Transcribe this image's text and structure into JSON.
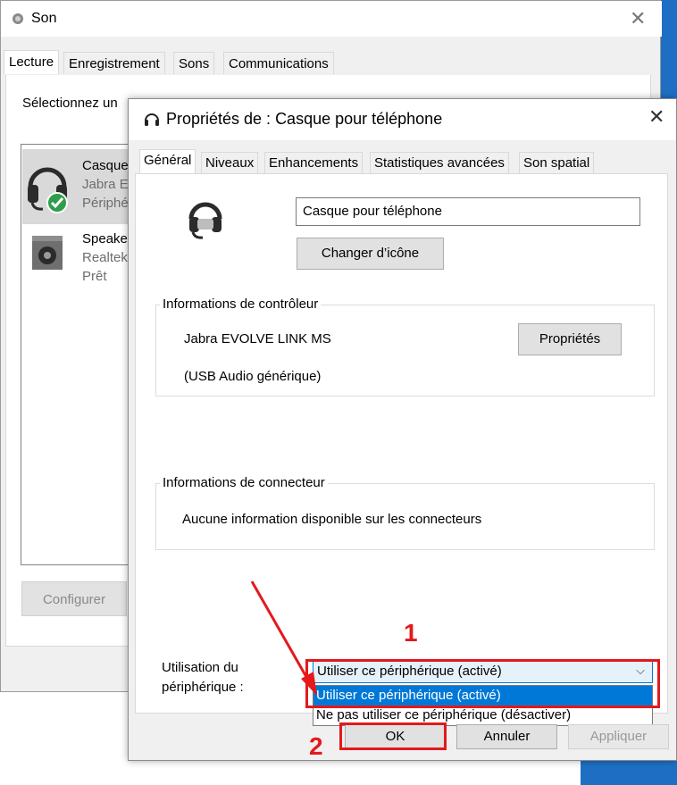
{
  "son_window": {
    "title": "Son",
    "tabs": [
      "Lecture",
      "Enregistrement",
      "Sons",
      "Communications"
    ],
    "instruction": "Sélectionnez un",
    "devices": [
      {
        "name": "Casque",
        "line2": "Jabra E",
        "line3": "Périphé",
        "selected": true
      },
      {
        "name": "Speake",
        "line2": "Realtek",
        "line3": "Prêt",
        "selected": false
      }
    ],
    "configure_button": "Configurer"
  },
  "prop_window": {
    "title": "Propriétés de : Casque pour téléphone",
    "tabs": [
      "Général",
      "Niveaux",
      "Enhancements",
      "Statistiques avancées",
      "Son spatial"
    ],
    "device_name": "Casque pour téléphone",
    "change_icon_button": "Changer d’icône",
    "controller_group": {
      "label": "Informations de contrôleur",
      "controller_name": "Jabra EVOLVE LINK MS",
      "driver": "(USB Audio générique)",
      "properties_button": "Propriétés"
    },
    "connector_group": {
      "label": "Informations de connecteur",
      "info": "Aucune information disponible sur les connecteurs"
    },
    "usage": {
      "label_line1": "Utilisation du",
      "label_line2": "périphérique :",
      "selected": "Utiliser ce périphérique (activé)",
      "options": [
        "Utiliser ce périphérique (activé)",
        "Ne pas utiliser ce périphérique (désactiver)"
      ]
    },
    "buttons": {
      "ok": "OK",
      "cancel": "Annuler",
      "apply": "Appliquer"
    }
  },
  "annotations": {
    "step1": "1",
    "step2": "2",
    "color": "#e3191c"
  },
  "colors": {
    "accent": "#0078d7",
    "selection_bg": "#0078d7",
    "panel_bg": "#f0f0f0"
  }
}
